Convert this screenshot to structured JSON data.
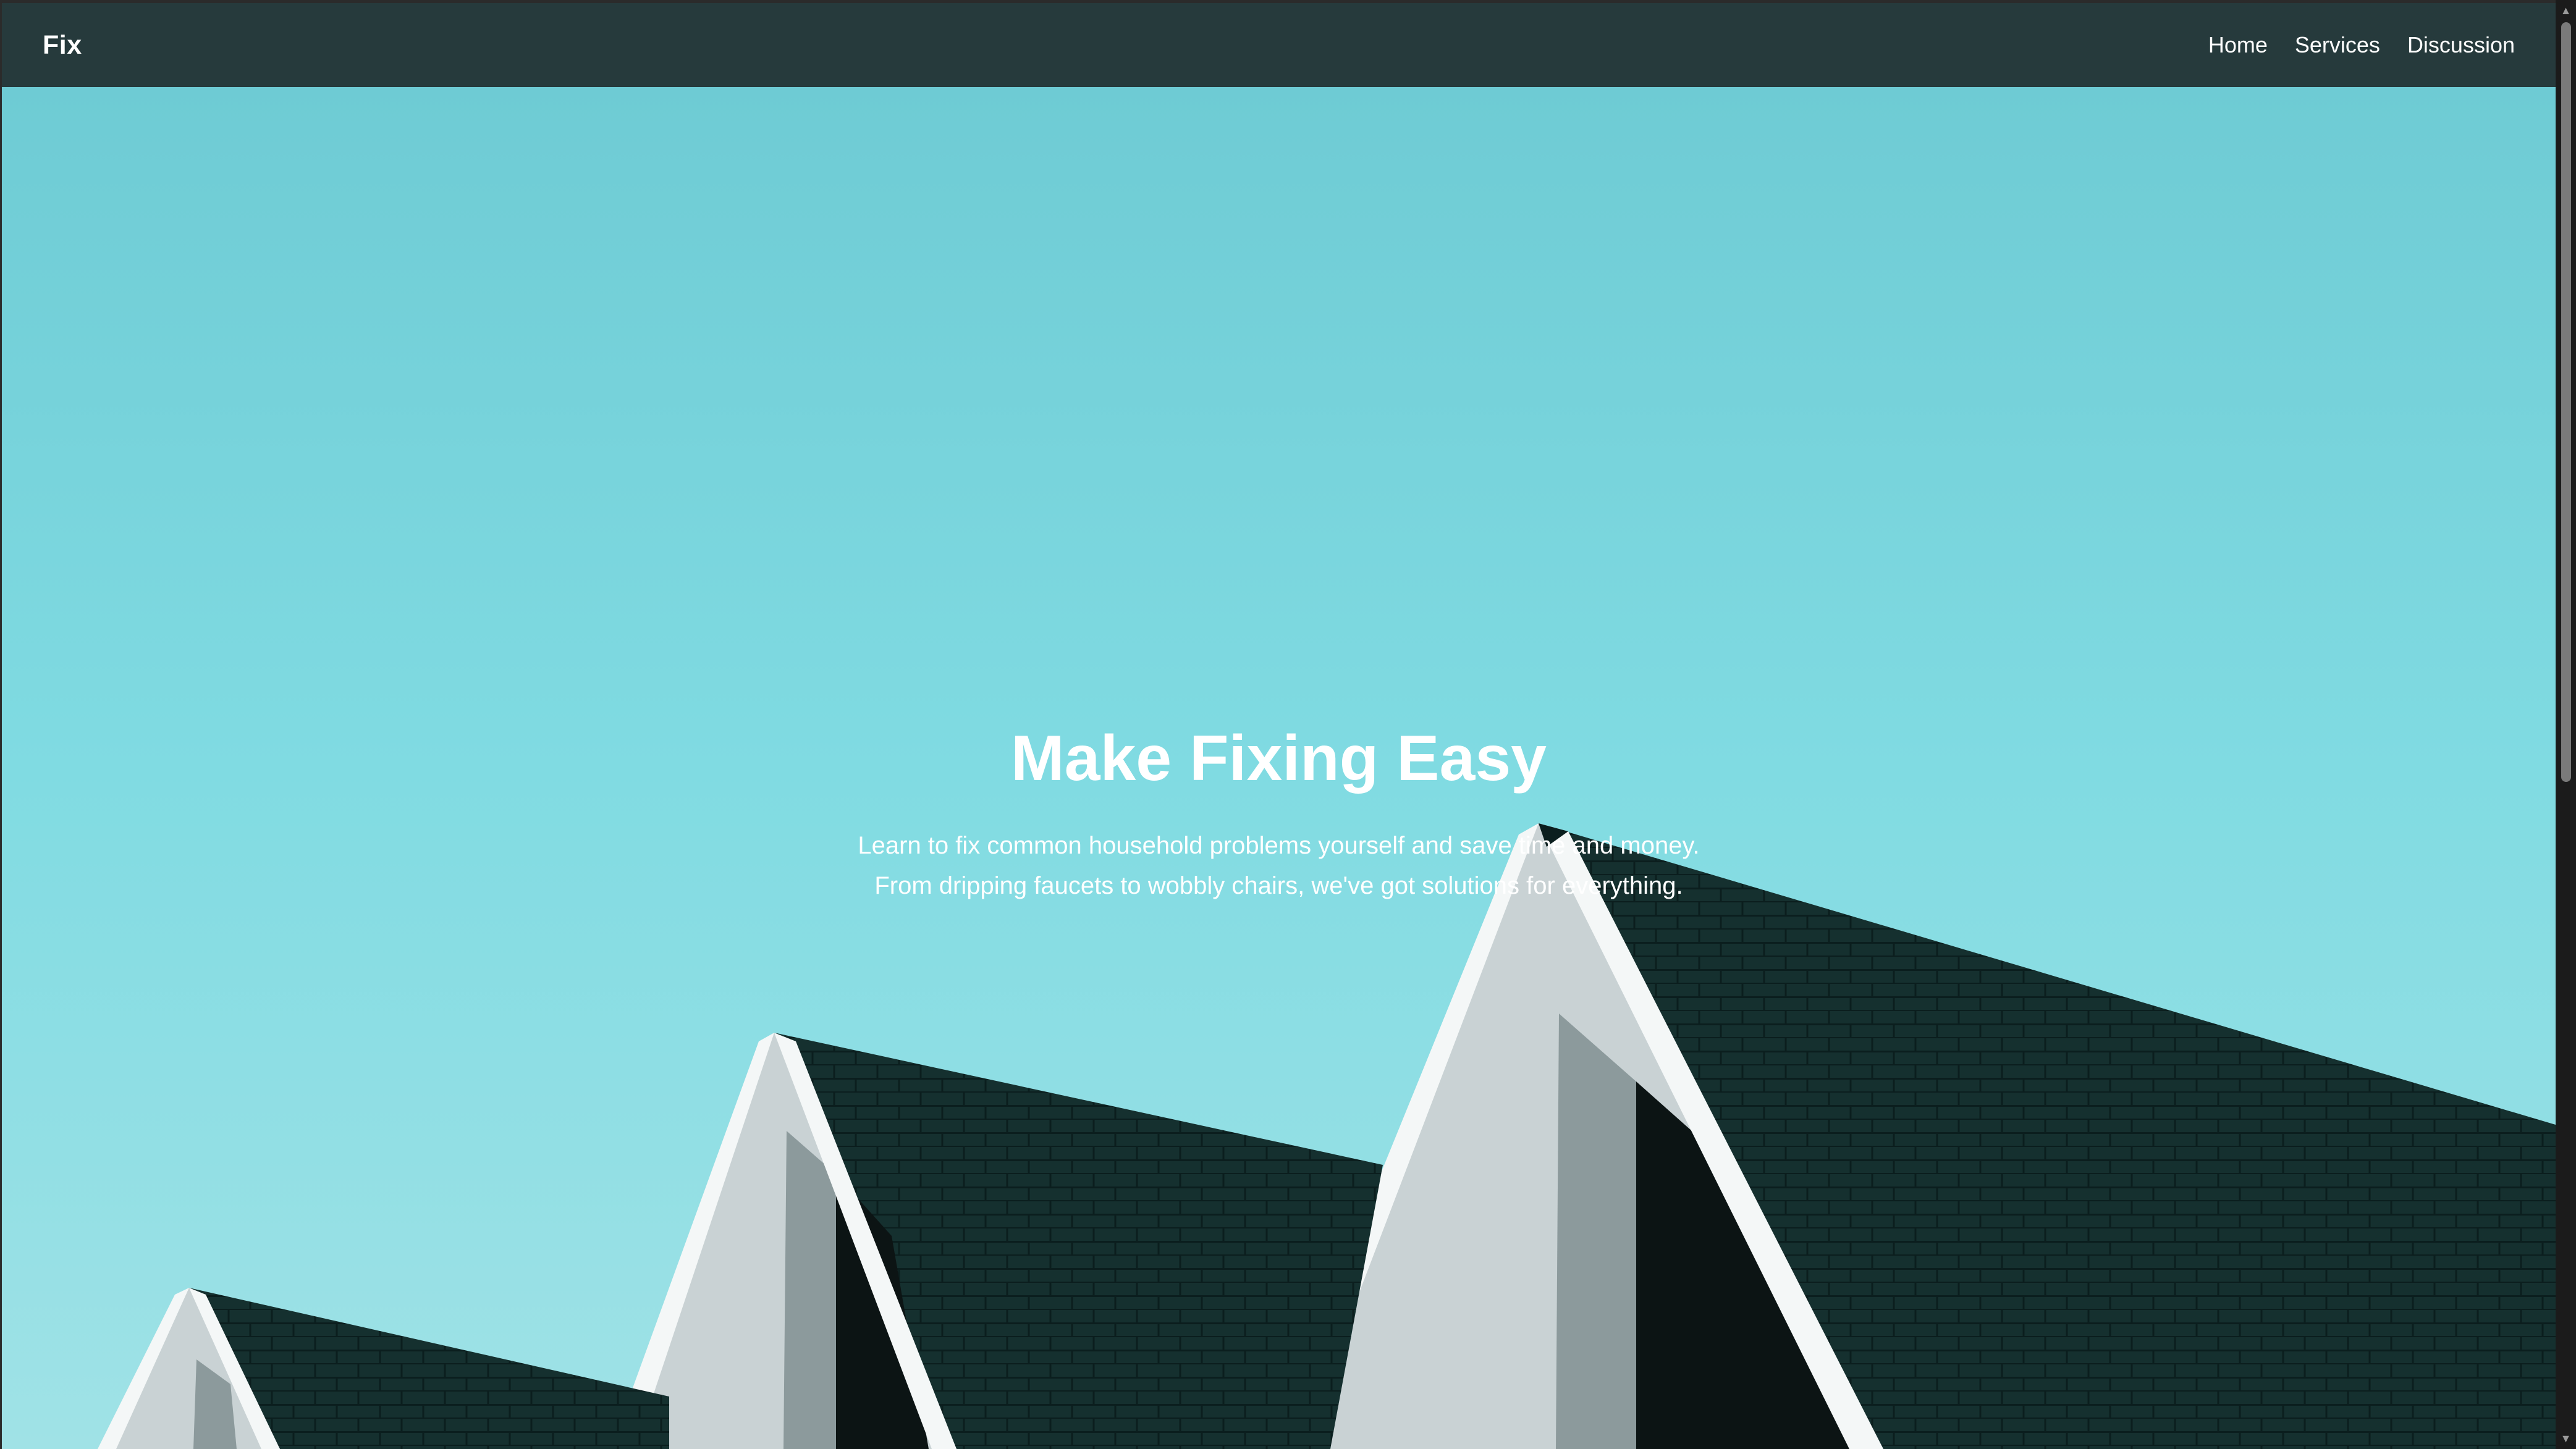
{
  "nav": {
    "brand": "Fix",
    "links": [
      "Home",
      "Services",
      "Discussion"
    ]
  },
  "hero": {
    "title": "Make Fixing Easy",
    "subtitle_lines": [
      "Learn to fix common household problems yourself and save time and money.",
      "From dripping faucets to wobbly chairs, we've got solutions for everything."
    ],
    "background_image": "rooftops-against-sky"
  },
  "colors": {
    "navbar": "#263a3c",
    "sky_top": "#6ecbd4",
    "sky_mid": "#80dbe2",
    "sky_bottom": "#a0e2e6",
    "roof": "#15302f",
    "wall": "#c9d2d4",
    "trim": "#f4f7f7",
    "text": "#ffffff"
  },
  "scrollbar": {
    "up_icon": "scroll-up-arrow-icon",
    "down_icon": "scroll-down-arrow-icon"
  }
}
